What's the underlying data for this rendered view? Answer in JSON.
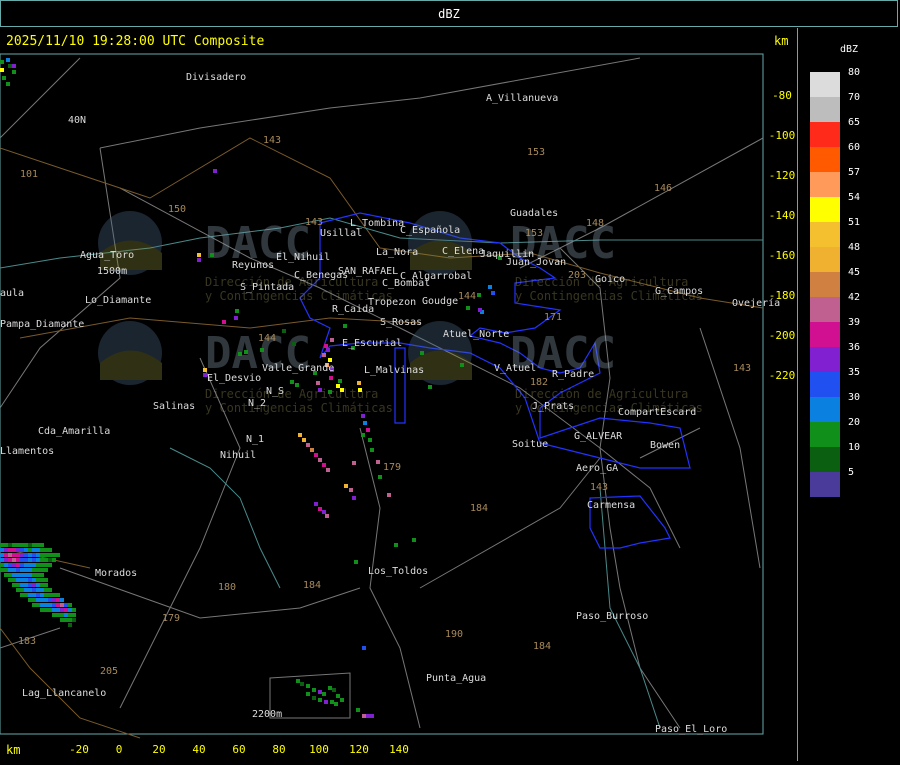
{
  "title": "dBZ",
  "timestamp": "2025/11/10 19:28:00 UTC Composite",
  "km_axis_label": "km",
  "axis": {
    "x_ticks": [
      "-20",
      "0",
      "20",
      "40",
      "60",
      "80",
      "100",
      "120",
      "140"
    ],
    "y_ticks": [
      "-80",
      "-100",
      "-120",
      "-140",
      "-160",
      "-180",
      "-200",
      "-220"
    ]
  },
  "legend": {
    "title": "dBZ",
    "entries": [
      {
        "value": "80",
        "color": "#dcdcdc"
      },
      {
        "value": "70",
        "color": "#bdbdbd"
      },
      {
        "value": "65",
        "color": "#ff2a1a"
      },
      {
        "value": "60",
        "color": "#ff5a00"
      },
      {
        "value": "57",
        "color": "#ff9a5a"
      },
      {
        "value": "54",
        "color": "#ffff00"
      },
      {
        "value": "51",
        "color": "#f5c030"
      },
      {
        "value": "48",
        "color": "#f0b030"
      },
      {
        "value": "45",
        "color": "#d08040"
      },
      {
        "value": "42",
        "color": "#c06090"
      },
      {
        "value": "39",
        "color": "#d01090"
      },
      {
        "value": "36",
        "color": "#8020d0"
      },
      {
        "value": "35",
        "color": "#2050f0"
      },
      {
        "value": "30",
        "color": "#0a80e0"
      },
      {
        "value": "20",
        "color": "#10901a"
      },
      {
        "value": "10",
        "color": "#0a6010"
      },
      {
        "value": "5",
        "color": "#4a3a9a"
      }
    ]
  },
  "places": [
    "Divisadero",
    "A_Villanueva",
    "Usillal",
    "L_Tombina",
    "C_Española",
    "La_Nora",
    "C_Elena",
    "Jaquillin",
    "Juan_Jovan",
    "Guadales",
    "Agua_Toro",
    "1500m",
    "Lo_Diamante",
    "Reyunos",
    "El_Nihuil",
    "S_Pintada",
    "C_Benegas",
    "SAN_RAFAEL",
    "C_Algarrobal",
    "C_Bombal",
    "Goico",
    "G_Campos",
    "Ovejería",
    "Tropezon",
    "Goudge",
    "R_Caida",
    "S_Rosas",
    "Atuel_Norte",
    "E_Escurial",
    "Pampa_Diamante",
    "Valle_Grande",
    "L_Malvinas",
    "V_Atuel",
    "R_Padre",
    "El_Desvio",
    "Salinas",
    "N_2",
    "N_S",
    "J_Prats",
    "CompartEscard",
    "Cda_Amarilla",
    "N_1",
    "Nihuil",
    "Soitue",
    "G_ALVEAR",
    "Bowen",
    "Aero_GA",
    "Carmensa",
    "Morados",
    "Los_Toldos",
    "Paso_Burroso",
    "Punta_Agua",
    "Lag_Llancanelo",
    "2200m",
    "Paso_El_Loro",
    "Llamentos",
    "aula",
    "40N"
  ],
  "route_numbers": [
    "143",
    "153",
    "146",
    "101",
    "150",
    "143",
    "153",
    "148",
    "203",
    "144",
    "171",
    "144",
    "182",
    "179",
    "143",
    "184",
    "180",
    "184",
    "179",
    "190",
    "184",
    "183",
    "205",
    "143"
  ],
  "watermark": {
    "brand": "DACC",
    "line1": "Dirección de Agricultura",
    "line2": "y Contingencias Climáticas"
  }
}
